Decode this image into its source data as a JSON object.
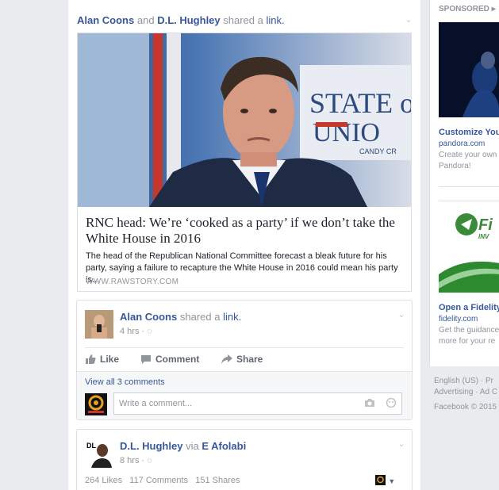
{
  "post1": {
    "author1": "Alan Coons",
    "conj": "and",
    "author2": "D.L. Hughley",
    "action": "shared a",
    "object": "link.",
    "image_text": {
      "line1": "STATE of",
      "line2": "UNIO",
      "line3": "CANDY CR"
    },
    "link_title": "RNC head: We’re ‘cooked as a party’ if we don’t take the White House in 2016",
    "link_desc": "The head of the Republican National Committee forecast a bleak future for his party, saying a failure to recapture the White House in 2016 could mean his party is...",
    "link_domain": "WWW.RAWSTORY.COM"
  },
  "post2": {
    "author": "Alan Coons",
    "action": "shared a",
    "object": "link.",
    "time": "4 hrs ·",
    "actions": {
      "like": "Like",
      "comment": "Comment",
      "share": "Share"
    },
    "view_all": "View all 3 comments",
    "comment_placeholder": "Write a comment..."
  },
  "post3": {
    "author": "D.L. Hughley",
    "via": "via",
    "via_author": "E Afolabi",
    "time": "8 hrs ·",
    "stats": {
      "likes": "264 Likes",
      "comments": "117 Comments",
      "shares": "151 Shares"
    }
  },
  "sidebar": {
    "sponsored": "SPONSORED",
    "ad1": {
      "title": "Customize You",
      "domain": "pandora.com",
      "line1": "Create your own",
      "line2": "Pandora!"
    },
    "ad2": {
      "brand": "Fi",
      "brand_sub": "INV",
      "title": "Open a Fidelity",
      "domain": "fidelity.com",
      "line1": "Get the guidance",
      "line2": "more for your re"
    },
    "footer": {
      "line1": "English (US) · Pr",
      "line2": "Advertising · Ad C",
      "line3": "Facebook © 2015"
    }
  },
  "colors": {
    "link": "#365899",
    "muted": "#90949c",
    "page_bg": "#e9ebee",
    "fidelity_green": "#3a8a3a"
  }
}
